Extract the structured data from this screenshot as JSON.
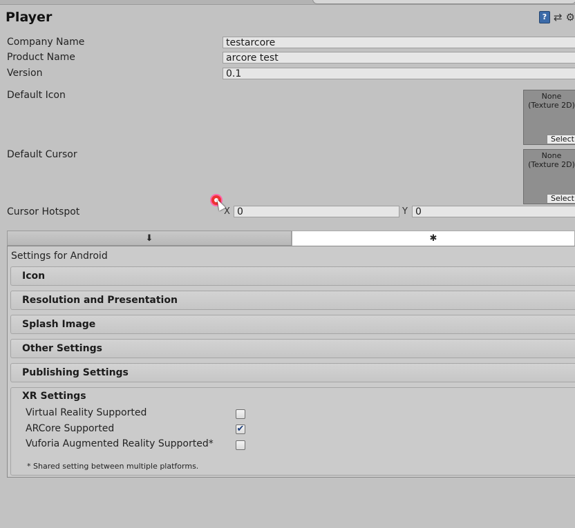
{
  "header": {
    "title": "Player",
    "icons": [
      "help-book-icon",
      "presets-icon",
      "gear-icon"
    ]
  },
  "fields": {
    "company_name": {
      "label": "Company Name",
      "value": "testarcore"
    },
    "product_name": {
      "label": "Product Name",
      "value": "arcore test"
    },
    "version": {
      "label": "Version",
      "value": "0.1"
    }
  },
  "default_icon": {
    "label": "Default Icon",
    "texture_none": "None",
    "texture_type": "(Texture 2D)",
    "select": "Select"
  },
  "default_cursor": {
    "label": "Default Cursor",
    "texture_none": "None",
    "texture_type": "(Texture 2D)",
    "select": "Select"
  },
  "cursor_hotspot": {
    "label": "Cursor Hotspot",
    "x_label": "X",
    "x_value": "0",
    "y_label": "Y",
    "y_value": "0"
  },
  "platform_tabs": [
    {
      "icon": "download-icon",
      "glyph": "⬇",
      "active": false
    },
    {
      "icon": "android-icon",
      "glyph": "✱",
      "active": true
    }
  ],
  "settings_for": "Settings for Android",
  "sections": [
    "Icon",
    "Resolution and Presentation",
    "Splash Image",
    "Other Settings",
    "Publishing Settings"
  ],
  "xr": {
    "title": "XR Settings",
    "options": [
      {
        "label": "Virtual Reality Supported",
        "checked": false
      },
      {
        "label": "ARCore Supported",
        "checked": true
      },
      {
        "label": "Vuforia Augmented Reality Supported*",
        "checked": false
      }
    ],
    "note": "* Shared setting between multiple platforms."
  },
  "colors": {
    "background": "#c2c2c2",
    "active_tab": "#ffffff",
    "checkbox_mark": "#1c3d7a"
  }
}
